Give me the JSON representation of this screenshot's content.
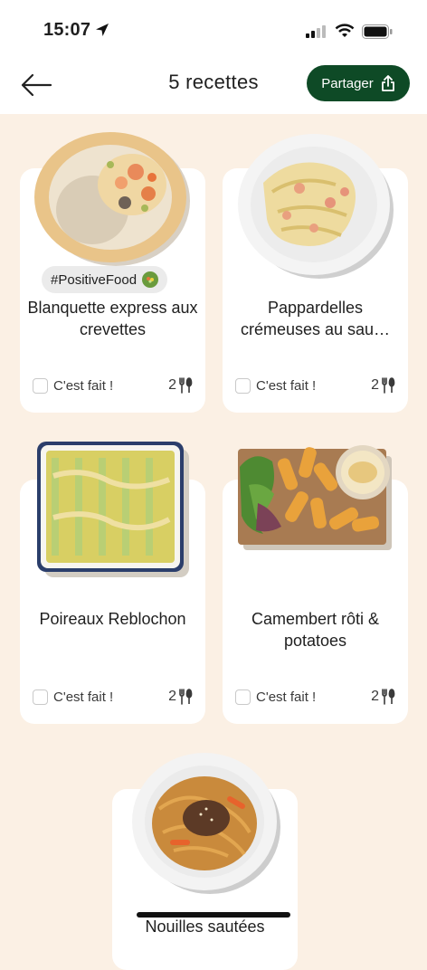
{
  "status_bar": {
    "time": "15:07"
  },
  "header": {
    "title": "5 recettes",
    "share_label": "Partager"
  },
  "recipes": [
    {
      "name": "Blanquette express aux crevettes",
      "tag": "#PositiveFood",
      "done_label": "C'est fait !",
      "portions": "2"
    },
    {
      "name": "Pappardelles crémeuses au sau…",
      "done_label": "C'est fait !",
      "portions": "2"
    },
    {
      "name": "Poireaux Reblochon",
      "done_label": "C'est fait !",
      "portions": "2"
    },
    {
      "name": "Camembert rôti & potatoes",
      "done_label": "C'est fait !",
      "portions": "2"
    },
    {
      "name": "Nouilles sautées"
    }
  ],
  "colors": {
    "brand_green": "#0e4a26",
    "background": "#fbf0e4"
  }
}
